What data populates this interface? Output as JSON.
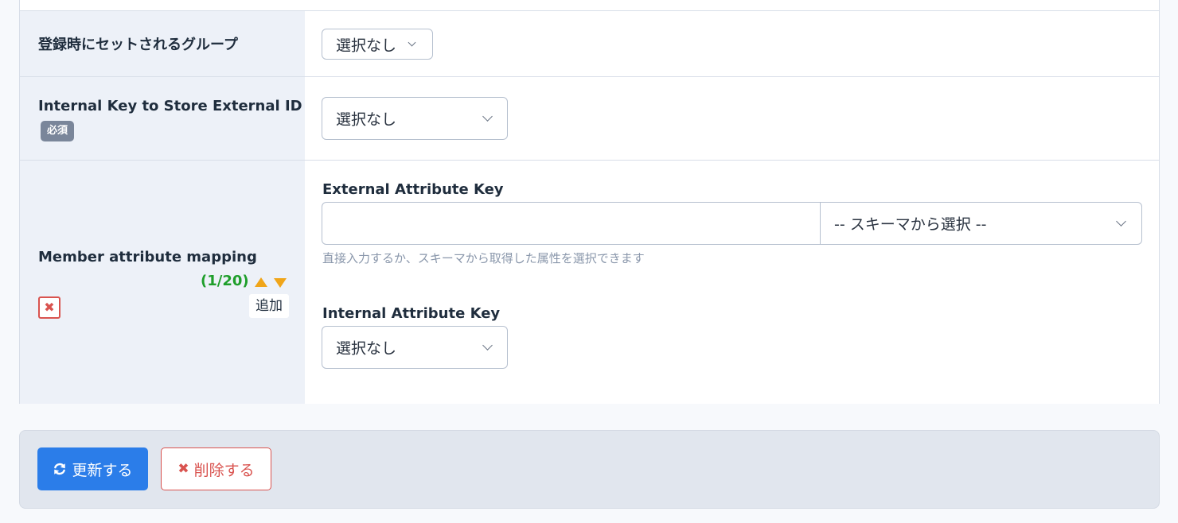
{
  "rows": {
    "group": {
      "label": "登録時にセットされるグループ",
      "select_value": "選択なし"
    },
    "internal_key": {
      "label": "Internal Key to Store External ID",
      "required_badge": "必須",
      "select_value": "選択なし"
    },
    "mapping": {
      "label": "Member attribute mapping",
      "counter": "(1/20)",
      "remove_icon": "✖",
      "add_label": "追加",
      "external_key_label": "External Attribute Key",
      "external_key_value": "",
      "schema_select_value": "-- スキーマから選択 --",
      "help_text": "直接入力するか、スキーマから取得した属性を選択できます",
      "internal_key_label": "Internal Attribute Key",
      "internal_select_value": "選択なし"
    }
  },
  "footer": {
    "update_label": "更新する",
    "delete_label": "削除する"
  },
  "colors": {
    "primary": "#2b7de9",
    "danger": "#d9534f",
    "counter_green": "#1e9e2a",
    "arrow_orange": "#f0a519",
    "label_bg": "#edf1f8"
  }
}
